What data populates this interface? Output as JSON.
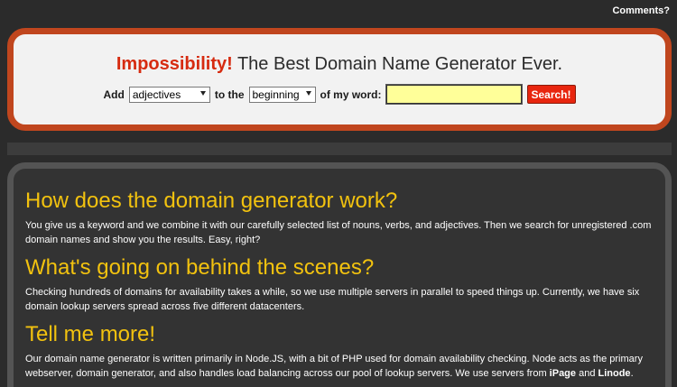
{
  "topbar": {
    "comments_link": "Comments?"
  },
  "header": {
    "brand": "Impossibility!",
    "tagline": " The Best Domain Name Generator Ever."
  },
  "form": {
    "label_add": "Add",
    "word_type_selected": "adjectives",
    "label_to_the": "to the",
    "position_selected": "beginning",
    "label_of_my_word": "of my word:",
    "word_value": "",
    "search_label": "Search!"
  },
  "sections": [
    {
      "heading": "How does the domain generator work?",
      "body": "You give us a keyword and we combine it with our carefully selected list of nouns, verbs, and adjectives. Then we search for unregistered .com domain names and show you the results. Easy, right?"
    },
    {
      "heading": "What's going on behind the scenes?",
      "body": "Checking hundreds of domains for availability takes a while, so we use multiple servers in parallel to speed things up. Currently, we have six domain lookup servers spread across five different datacenters."
    },
    {
      "heading": "Tell me more!",
      "body_prefix": "Our domain name generator is written primarily in Node.JS, with a bit of PHP used for domain availability checking. Node acts as the primary webserver, domain generator, and also handles load balancing across our pool of lookup servers. We use servers from ",
      "host_1": "iPage",
      "body_and": " and ",
      "host_2": "Linode",
      "body_suffix": "."
    }
  ]
}
